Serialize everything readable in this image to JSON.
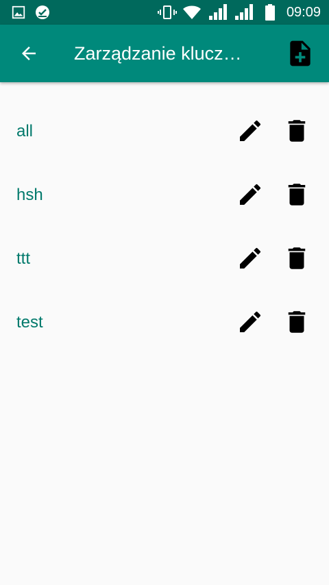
{
  "status_bar": {
    "time": "09:09",
    "icons": [
      "image-icon",
      "checkmark-badge-icon",
      "vibrate-icon",
      "wifi-icon",
      "signal-icon",
      "signal-icon",
      "battery-icon"
    ]
  },
  "app_bar": {
    "title": "Zarządzanie klucz…",
    "back_icon": "arrow-back-icon",
    "action_icon": "note-add-icon",
    "background": "#00897b"
  },
  "colors": {
    "status_bar": "#00695c",
    "app_bar": "#00897b",
    "item_text": "#00796b",
    "icons": "#000000",
    "background": "#fafafa"
  },
  "list": {
    "items": [
      {
        "label": "all"
      },
      {
        "label": "hsh"
      },
      {
        "label": "ttt"
      },
      {
        "label": "test"
      }
    ],
    "row_actions": [
      "edit-icon",
      "delete-icon"
    ]
  }
}
